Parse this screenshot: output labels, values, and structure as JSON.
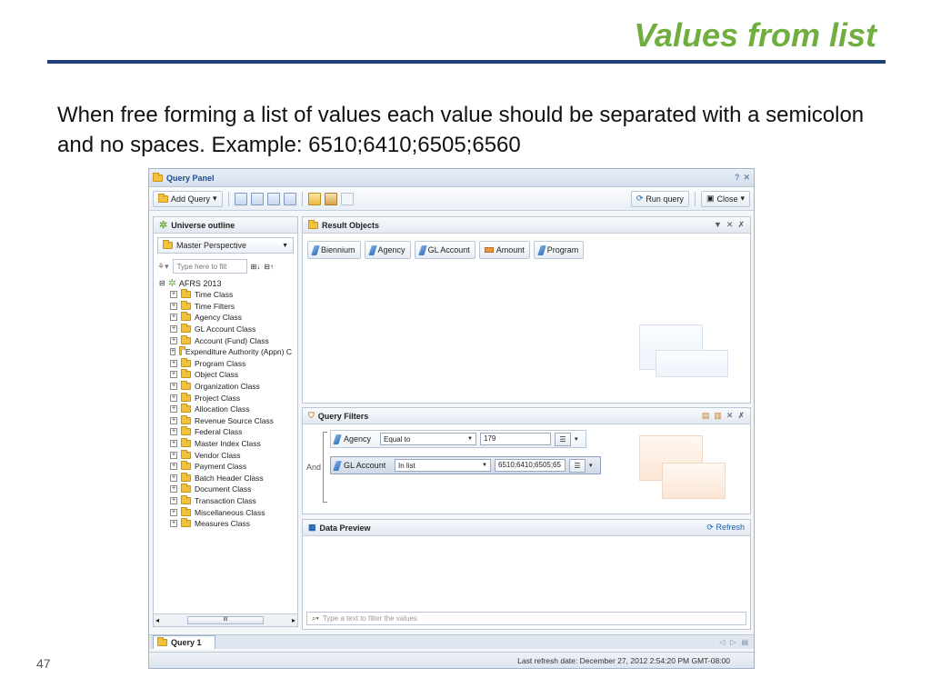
{
  "slide": {
    "title": "Values from list",
    "body": "When free forming a list of values each value should be separated with a semicolon and no spaces. Example: 6510;6410;6505;6560",
    "page_number": "47"
  },
  "window": {
    "title": "Query Panel",
    "toolbar": {
      "add_query": "Add Query",
      "run_query": "Run query",
      "close": "Close"
    }
  },
  "universe_outline": {
    "header": "Universe outline",
    "perspective": "Master Perspective",
    "filter_placeholder": "Type here to filt",
    "root": "AFRS 2013",
    "classes": [
      "Time Class",
      "Time Filters",
      "Agency Class",
      "GL Account Class",
      "Account (Fund) Class",
      "Expenditure Authority (Appn) C",
      "Program Class",
      "Object Class",
      "Organization Class",
      "Project Class",
      "Allocation Class",
      "Revenue Source Class",
      "Federal Class",
      "Master Index Class",
      "Vendor Class",
      "Payment Class",
      "Batch Header Class",
      "Document Class",
      "Transaction Class",
      "Miscellaneous Class",
      "Measures Class"
    ],
    "scroll_thumb": "III"
  },
  "result_objects": {
    "header": "Result Objects",
    "objects": [
      {
        "label": "Biennium",
        "kind": "dimension"
      },
      {
        "label": "Agency",
        "kind": "dimension"
      },
      {
        "label": "GL Account",
        "kind": "dimension"
      },
      {
        "label": "Amount",
        "kind": "measure"
      },
      {
        "label": "Program",
        "kind": "dimension"
      }
    ]
  },
  "query_filters": {
    "header": "Query Filters",
    "and_label": "And",
    "filters": [
      {
        "object": "Agency",
        "operator": "Equal to",
        "operand": "179"
      },
      {
        "object": "GL Account",
        "operator": "In list",
        "operand": "6510;6410;6505;65"
      }
    ]
  },
  "data_preview": {
    "header": "Data Preview",
    "refresh": "Refresh",
    "filter_placeholder": "Type a text to filter the values"
  },
  "tabs": [
    {
      "label": "Query 1"
    }
  ],
  "status": {
    "last_refresh": "Last refresh date: December 27, 2012 2:54:20 PM GMT-08:00"
  },
  "colors": {
    "title_green": "#6fae3f",
    "rule_navy": "#1f3f7a",
    "panel_border": "#9fb3cc"
  }
}
